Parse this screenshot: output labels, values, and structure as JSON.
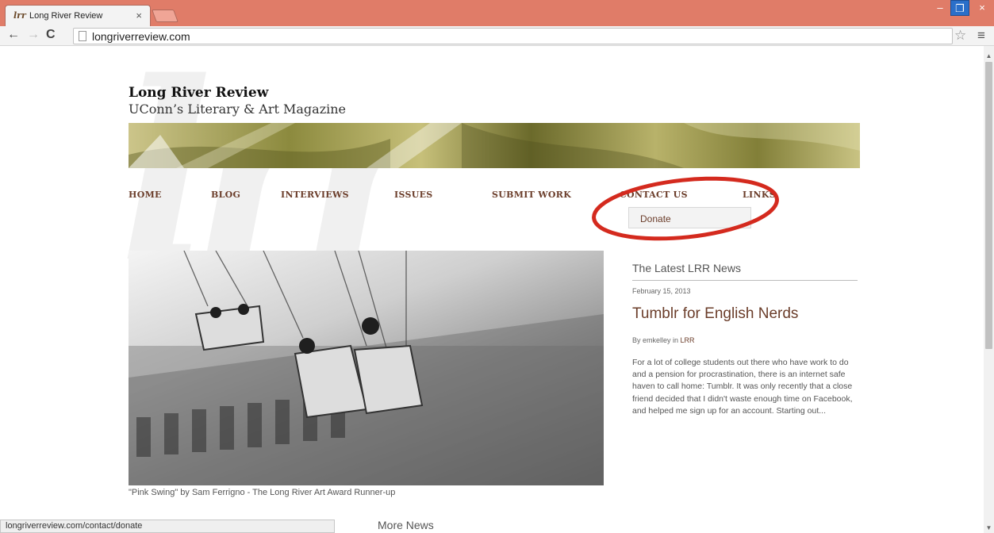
{
  "browser": {
    "tab_title": "Long River Review",
    "tab_favicon_text": "lrr",
    "tab_close": "×",
    "url": "longriverreview.com",
    "window_buttons": {
      "minimize": "–",
      "maximize": "❐",
      "close": "×"
    },
    "nav_icons": {
      "back": "←",
      "forward": "→",
      "reload": "C",
      "star": "☆",
      "menu": "≡"
    }
  },
  "site": {
    "watermark": "lrr",
    "title": "Long River Review",
    "subtitle": "UConn’s Literary & Art Magazine"
  },
  "nav": {
    "items": [
      "HOME",
      "BLOG",
      "INTERVIEWS",
      "ISSUES",
      "SUBMIT WORK",
      "CONTACT US",
      "LINKS"
    ],
    "dropdown_item": "Donate"
  },
  "hero": {
    "caption": "\"Pink Swing\" by Sam Ferrigno - The Long River Art Award Runner-up"
  },
  "news": {
    "heading": "The Latest LRR News",
    "date": "February 15, 2013",
    "title": "Tumblr for English Nerds",
    "by_prefix": "By emkelley in",
    "category": "LRR",
    "excerpt": "For a lot of college students out there who have work to do and a pension for procrastination, there is an internet safe haven to call home: Tumblr. It was only recently that a close friend decided that I didn't waste enough time on Facebook, and helped me sign up for an account. Starting out..."
  },
  "more_news": "More News",
  "status_url": "longriverreview.com/contact/donate",
  "colors": {
    "titlebar": "#e07c68",
    "nav_link": "#6b3d2a",
    "highlight_circle": "#d42a1e"
  }
}
